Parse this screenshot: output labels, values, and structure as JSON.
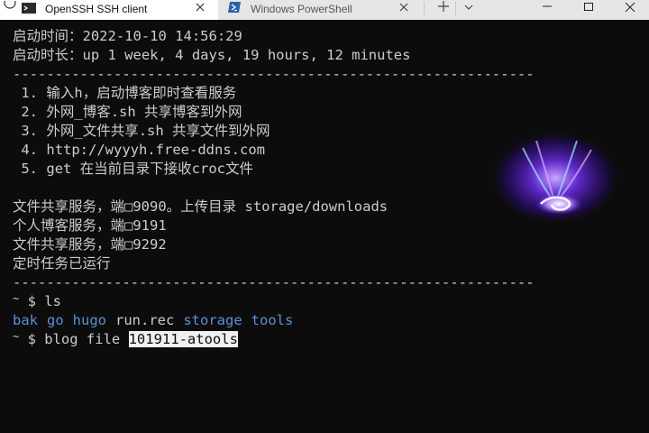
{
  "tabs": [
    {
      "title": "OpenSSH SSH client",
      "icon": "terminal-app-icon",
      "active": true
    },
    {
      "title": "Windows PowerShell",
      "icon": "powershell-icon",
      "active": false
    }
  ],
  "toolbar": {
    "new_tab_icon": "plus-icon",
    "dropdown_icon": "chevron-down-icon",
    "window_controls": [
      "minimize-icon",
      "maximize-icon",
      "close-icon"
    ]
  },
  "terminal": {
    "start_time_label": "启动时间：",
    "start_time_value": "2022-10-10 14:56:29",
    "uptime_label": "启动时长：",
    "uptime_value": "up 1 week, 4 days, 19 hours, 12 minutes",
    "divider": "--------------------------------------------------------------",
    "menu": [
      {
        "num": "1.",
        "text": "输入h，启动博客即时查看服务"
      },
      {
        "num": "2.",
        "text": "外网_博客.sh 共享博客到外网"
      },
      {
        "num": "3.",
        "text": "外网_文件共享.sh 共享文件到外网"
      },
      {
        "num": "4.",
        "text": "http://wyyyh.free-ddns.com"
      },
      {
        "num": "5.",
        "text": "get 在当前目录下接收croc文件"
      }
    ],
    "services": [
      "文件共享服务，端□9090。上传目录 storage/downloads",
      "个人博客服务，端□9191",
      "文件共享服务，端□9292",
      "定时任务已运行"
    ],
    "prompt_symbol": "~",
    "prompt_dollar": "$",
    "command_1": "ls",
    "ls_output": [
      {
        "name": "bak",
        "type": "dir"
      },
      {
        "name": "go",
        "type": "dir"
      },
      {
        "name": "hugo",
        "type": "dir"
      },
      {
        "name": "run.rec",
        "type": "file"
      },
      {
        "name": "storage",
        "type": "dir"
      },
      {
        "name": "tools",
        "type": "dir"
      }
    ],
    "command_2_prefix": "blog file ",
    "command_2_selected": "101911-atools"
  },
  "colors": {
    "terminal_bg": "#0c0c0c",
    "terminal_fg": "#cccccc",
    "directory_blue": "#5e8fd0",
    "tab_bar": "#e6e6e6",
    "active_tab": "#ffffff"
  }
}
